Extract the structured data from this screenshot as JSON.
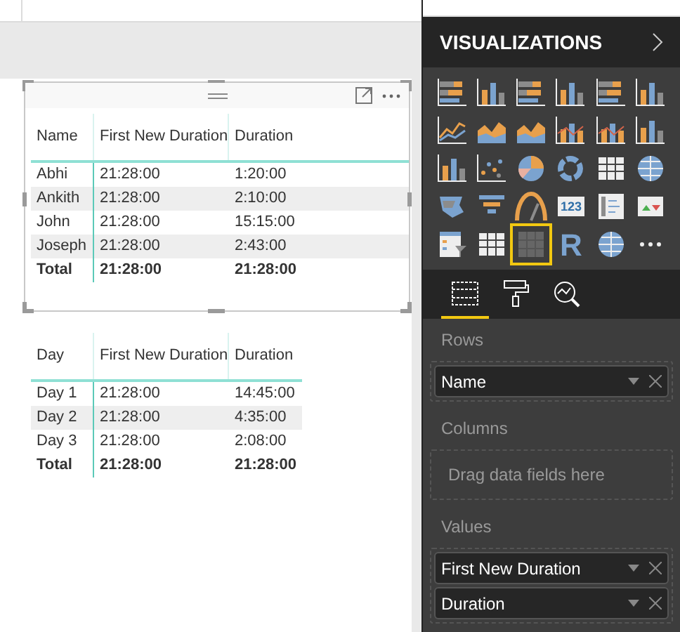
{
  "tables": [
    {
      "columns": [
        "Name",
        "First New Duration",
        "Duration"
      ],
      "rows": [
        {
          "cells": [
            "Abhi",
            "21:28:00",
            "1:20:00"
          ]
        },
        {
          "cells": [
            "Ankith",
            "21:28:00",
            "2:10:00"
          ]
        },
        {
          "cells": [
            "John",
            "21:28:00",
            "15:15:00"
          ]
        },
        {
          "cells": [
            "Joseph",
            "21:28:00",
            "2:43:00"
          ]
        }
      ],
      "total": [
        "Total",
        "21:28:00",
        "21:28:00"
      ],
      "selected": true
    },
    {
      "columns": [
        "Day",
        "First New Duration",
        "Duration"
      ],
      "rows": [
        {
          "cells": [
            "Day 1",
            "21:28:00",
            "14:45:00"
          ]
        },
        {
          "cells": [
            "Day 2",
            "21:28:00",
            "4:35:00"
          ]
        },
        {
          "cells": [
            "Day 3",
            "21:28:00",
            "2:08:00"
          ]
        }
      ],
      "total": [
        "Total",
        "21:28:00",
        "21:28:00"
      ],
      "selected": false
    }
  ],
  "panel": {
    "title": "VISUALIZATIONS",
    "visuals": [
      {
        "kind": "hbar",
        "selected": false
      },
      {
        "kind": "vbar",
        "selected": false
      },
      {
        "kind": "hbar",
        "selected": false
      },
      {
        "kind": "vbar",
        "selected": false
      },
      {
        "kind": "hbar",
        "selected": false
      },
      {
        "kind": "vbar",
        "selected": false
      },
      {
        "kind": "line",
        "selected": false
      },
      {
        "kind": "area",
        "selected": false
      },
      {
        "kind": "area",
        "selected": false
      },
      {
        "kind": "combo",
        "selected": false
      },
      {
        "kind": "combo",
        "selected": false
      },
      {
        "kind": "vbar",
        "selected": false
      },
      {
        "kind": "vbar",
        "selected": false
      },
      {
        "kind": "scatter",
        "selected": false
      },
      {
        "kind": "pie",
        "selected": false
      },
      {
        "kind": "donut",
        "selected": false
      },
      {
        "kind": "table",
        "selected": false
      },
      {
        "kind": "globe",
        "selected": false
      },
      {
        "kind": "map",
        "selected": false
      },
      {
        "kind": "funnel",
        "selected": false
      },
      {
        "kind": "gauge",
        "selected": false
      },
      {
        "kind": "card",
        "label": "123",
        "selected": false
      },
      {
        "kind": "list",
        "selected": false
      },
      {
        "kind": "kpi",
        "selected": false
      },
      {
        "kind": "slicer",
        "selected": false
      },
      {
        "kind": "table",
        "selected": false
      },
      {
        "kind": "matrix",
        "selected": true
      },
      {
        "kind": "text",
        "label": "R",
        "selected": false
      },
      {
        "kind": "globe",
        "selected": false
      },
      {
        "kind": "more",
        "selected": false
      }
    ],
    "tabs": [
      {
        "kind": "fields",
        "selected": true
      },
      {
        "kind": "format",
        "selected": false
      },
      {
        "kind": "analytics",
        "selected": false
      }
    ],
    "wells": [
      {
        "label": "Rows",
        "fields": [
          "Name"
        ]
      },
      {
        "label": "Columns",
        "placeholder": "Drag data fields here"
      },
      {
        "label": "Values",
        "fields": [
          "First New Duration",
          "Duration"
        ]
      }
    ]
  }
}
